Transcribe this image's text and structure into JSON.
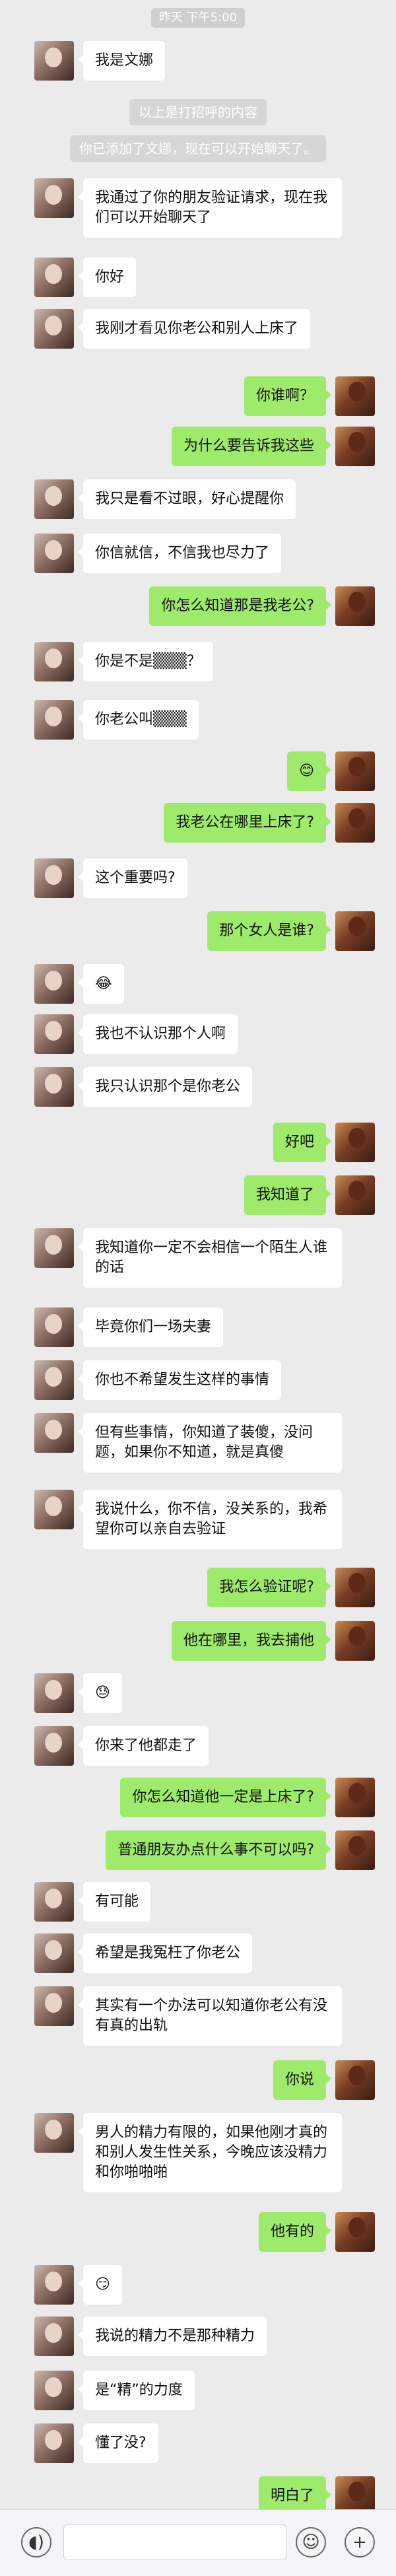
{
  "time_label": "昨天 下午5:00",
  "system_notices": [
    "以上是打招呼的内容",
    "你已添加了文娜，现在可以开始聊天了。"
  ],
  "messages": [
    {
      "side": "left",
      "text": "我是文娜"
    },
    {
      "side": "left",
      "text": "我通过了你的朋友验证请求，现在我们可以开始聊天了"
    },
    {
      "side": "left",
      "text": "你好"
    },
    {
      "side": "left",
      "text": "我刚才看见你老公和别人上床了"
    },
    {
      "side": "right",
      "text": "你谁啊？"
    },
    {
      "side": "right",
      "text": "为什么要告诉我这些"
    },
    {
      "side": "left",
      "text": "我只是看不过眼，好心提醒你"
    },
    {
      "side": "left",
      "text": "你信就信，不信我也尽力了"
    },
    {
      "side": "right",
      "text": "你怎么知道那是我老公?"
    },
    {
      "side": "left",
      "text": "你是不是▒▒▒？"
    },
    {
      "side": "left",
      "text": "你老公叫▒▒▒"
    },
    {
      "side": "right",
      "text": "😊"
    },
    {
      "side": "right",
      "text": "我老公在哪里上床了?"
    },
    {
      "side": "left",
      "text": "这个重要吗?"
    },
    {
      "side": "right",
      "text": "那个女人是谁?"
    },
    {
      "side": "left",
      "text": "😂"
    },
    {
      "side": "left",
      "text": "我也不认识那个人啊"
    },
    {
      "side": "left",
      "text": "我只认识那个是你老公"
    },
    {
      "side": "right",
      "text": "好吧"
    },
    {
      "side": "right",
      "text": "我知道了"
    },
    {
      "side": "left",
      "text": "我知道你一定不会相信一个陌生人谁的话"
    },
    {
      "side": "left",
      "text": "毕竟你们一场夫妻"
    },
    {
      "side": "left",
      "text": "你也不希望发生这样的事情"
    },
    {
      "side": "left",
      "text": "但有些事情，你知道了装傻，没问题，如果你不知道，就是真傻"
    },
    {
      "side": "left",
      "text": "我说什么，你不信，没关系的，我希望你可以亲自去验证"
    },
    {
      "side": "right",
      "text": "我怎么验证呢?"
    },
    {
      "side": "right",
      "text": "他在哪里，我去捕他"
    },
    {
      "side": "left",
      "text": "😓"
    },
    {
      "side": "left",
      "text": "你来了他都走了"
    },
    {
      "side": "right",
      "text": "你怎么知道他一定是上床了?"
    },
    {
      "side": "right",
      "text": "普通朋友办点什么事不可以吗?"
    },
    {
      "side": "left",
      "text": "有可能"
    },
    {
      "side": "left",
      "text": "希望是我冤枉了你老公"
    },
    {
      "side": "left",
      "text": "其实有一个办法可以知道你老公有没有真的出轨"
    },
    {
      "side": "right",
      "text": "你说"
    },
    {
      "side": "left",
      "text": "男人的精力有限的，如果他刚才真的和别人发生性关系，今晚应该没精力和你啪啪啪"
    },
    {
      "side": "right",
      "text": "他有的"
    },
    {
      "side": "left",
      "text": "😏"
    },
    {
      "side": "left",
      "text": "我说的精力不是那种精力"
    },
    {
      "side": "left",
      "text": "是“精”的力度"
    },
    {
      "side": "left",
      "text": "懂了没?"
    },
    {
      "side": "right",
      "text": "明白了"
    }
  ],
  "icons": {
    "voice": "voice-icon",
    "emoji": "emoji-icon",
    "plus": "plus-icon"
  },
  "colors": {
    "background": "#ebebeb",
    "self_bubble": "#9eea6a",
    "other_bubble": "#ffffff",
    "input_bar": "#f5f5f7"
  }
}
